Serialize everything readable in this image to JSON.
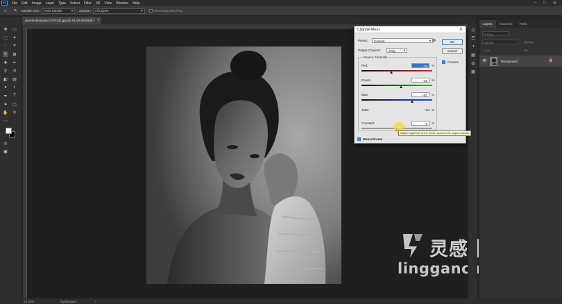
{
  "menubar": {
    "items": [
      "File",
      "Edit",
      "Image",
      "Layer",
      "Type",
      "Select",
      "Filter",
      "3D",
      "View",
      "Window",
      "Help"
    ],
    "logo": "Ps"
  },
  "options": {
    "sample_size_label": "Sample Size:",
    "sample_size_value": "Point Sample",
    "sample_label": "Sample:",
    "sample_value": "All Layers",
    "show_ring_label": "Show Sampling Ring"
  },
  "document": {
    "tab_title": "pexels-ali-pazani-2787341.jpg @ 33.3% (RGB/8) *",
    "close_glyph": "×"
  },
  "status": {
    "zoom": "33.33%",
    "tool": "Eyedropper"
  },
  "layers_panel": {
    "tabs": [
      "Layers",
      "Channels",
      "Paths"
    ],
    "kind_placeholder": "Kind",
    "mode": "Normal",
    "opacity_label": "Opacity:",
    "lock_label": "Lock:",
    "fill_label": "Fill:",
    "layer_name": "Background"
  },
  "dialog": {
    "title": "Channel Mixer",
    "preset_label": "Preset:",
    "preset_value": "Custom",
    "output_label": "Output Channel:",
    "output_value": "Gray",
    "source_label": "Source Channels",
    "red_label": "Red:",
    "red_value": "-29",
    "green_label": "Green:",
    "green_value": "+26",
    "blue_label": "Blue:",
    "blue_value": "+87",
    "total_label": "Total:",
    "total_value": "+84",
    "constant_label": "Constant:",
    "constant_value": "0",
    "percent": "%",
    "monochrome_label": "Monochrome",
    "ok_label": "OK",
    "cancel_label": "Cancel",
    "preview_label": "Preview",
    "tooltip": "Adjust brightness of the result, saved to the output channel"
  },
  "sliders": {
    "red": -29,
    "green": 26,
    "blue": 87,
    "constant": 0,
    "range": [
      -200,
      200
    ]
  },
  "watermark": {
    "brand": "灵感中国",
    "url": "lingganchina.com"
  }
}
